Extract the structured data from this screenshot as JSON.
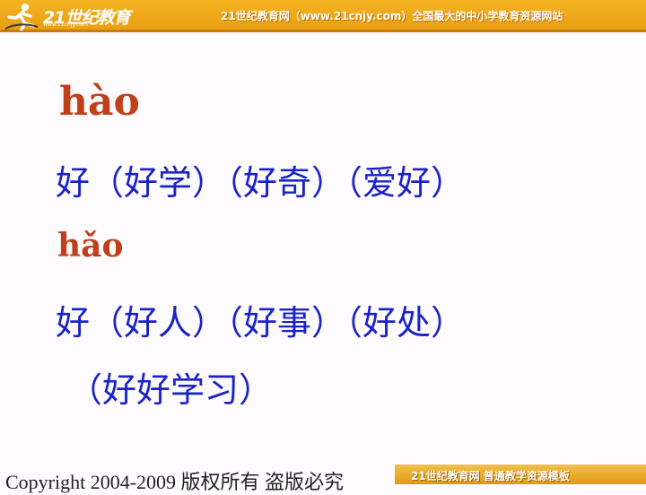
{
  "header": {
    "logo_text": "21世纪教育",
    "logo_sub": "www.21cnjy.com",
    "tagline": "21世纪教育网（www.21cnjy.com）全国最大的中小学教育资源网站"
  },
  "content": {
    "pinyin_1": "hào",
    "line_1": "好（好学）（好奇）（爱好）",
    "pinyin_2": "hǎo",
    "line_2": "好（好人）（好事）（好处）",
    "line_3": "（好好学习）"
  },
  "footer": {
    "copyright": "Copyright 2004-2009 版权所有 盗版必究",
    "band_text": "21世纪教育网    普通教学资源模板"
  }
}
